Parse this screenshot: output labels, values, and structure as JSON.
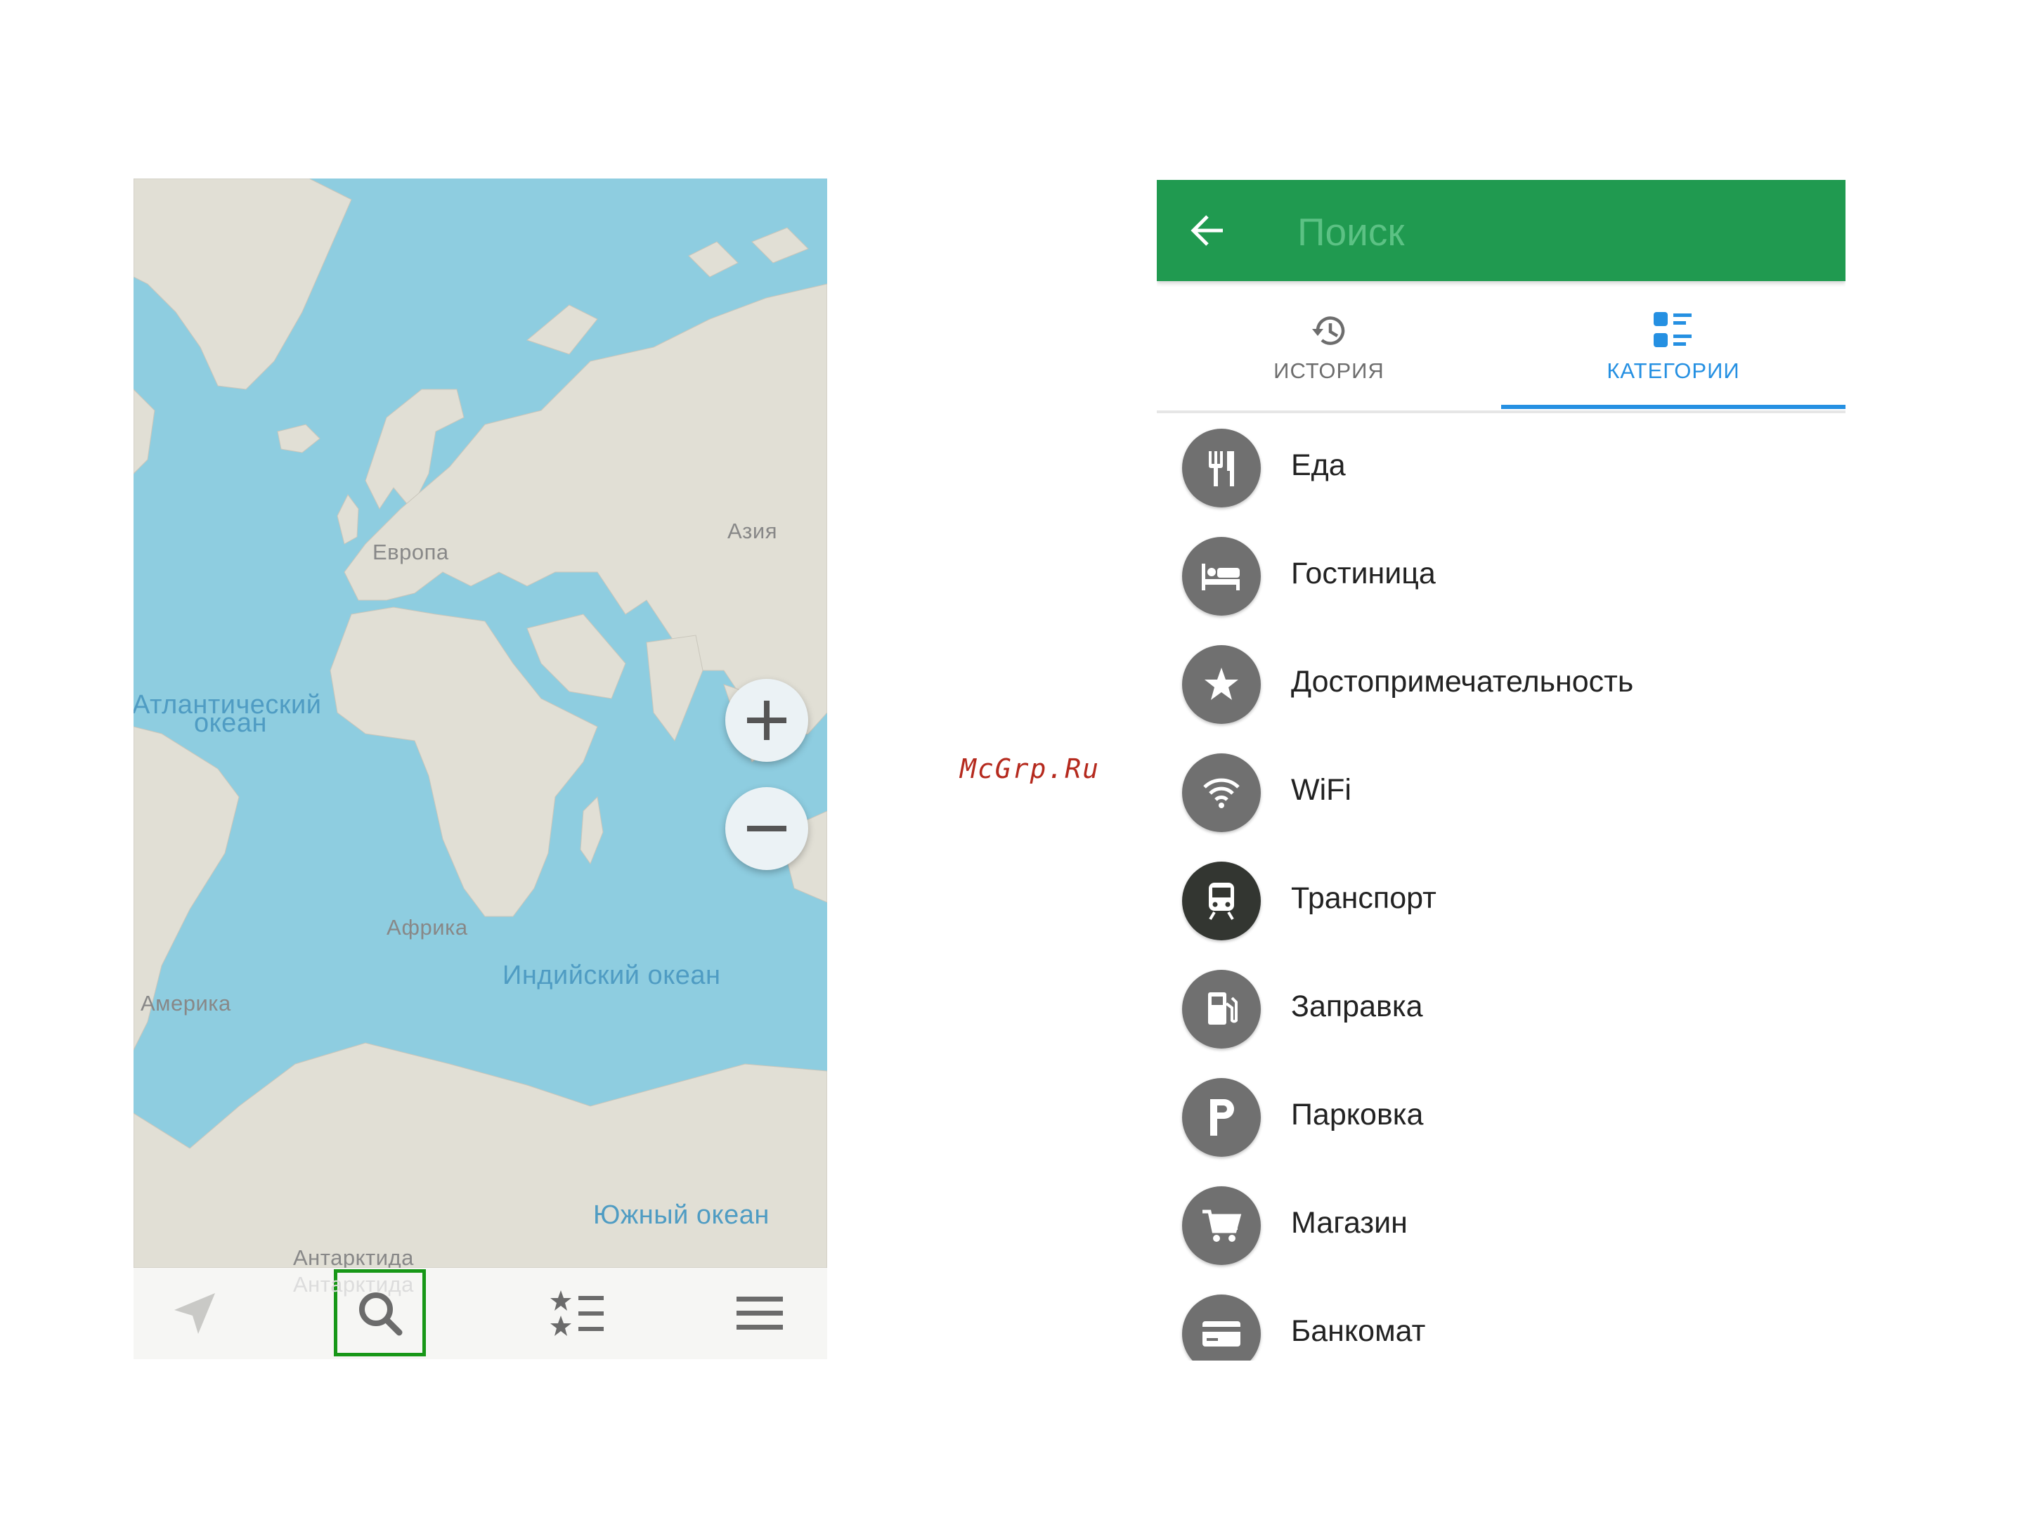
{
  "map_screen": {
    "labels": {
      "europe": "Европа",
      "asia": "Азия",
      "africa": "Африка",
      "america": "Америка",
      "antarctica": "Антарктида",
      "antarctica_ghost": "Антарктида",
      "atlantic_line1": "Атлантический",
      "atlantic_line2": "океан",
      "indian": "Индийский океан",
      "southern": "Южный океан"
    },
    "zoom": {
      "in_icon": "plus-icon",
      "out_icon": "minus-icon"
    },
    "bottom_bar": [
      {
        "name": "navigation",
        "icon": "navigation-arrow-icon"
      },
      {
        "name": "search",
        "icon": "search-icon",
        "highlighted": true
      },
      {
        "name": "bookmarks",
        "icon": "star-list-icon"
      },
      {
        "name": "menu",
        "icon": "hamburger-icon"
      }
    ],
    "colors": {
      "water": "#8ecde0",
      "land": "#e1dfd5",
      "highlight": "#179717"
    }
  },
  "watermark": "McGrp.Ru",
  "search_screen": {
    "toolbar": {
      "placeholder": "Поиск",
      "back_icon": "back-arrow-icon",
      "color": "#209a50"
    },
    "tabs": [
      {
        "label": "ИСТОРИЯ",
        "icon": "history-icon",
        "active": false
      },
      {
        "label": "КАТЕГОРИИ",
        "icon": "categories-icon",
        "active": true
      }
    ],
    "categories": [
      {
        "label": "Еда",
        "icon": "food-icon"
      },
      {
        "label": "Гостиница",
        "icon": "hotel-icon"
      },
      {
        "label": "Достопримечательность",
        "icon": "star-icon"
      },
      {
        "label": "WiFi",
        "icon": "wifi-icon"
      },
      {
        "label": "Транспорт",
        "icon": "train-icon"
      },
      {
        "label": "Заправка",
        "icon": "fuel-icon"
      },
      {
        "label": "Парковка",
        "icon": "parking-icon"
      },
      {
        "label": "Магазин",
        "icon": "cart-icon"
      },
      {
        "label": "Банкомат",
        "icon": "atm-card-icon"
      }
    ],
    "colors": {
      "accent": "#2590e2",
      "icon_bg": "#707070",
      "icon_bg_active": "#333631"
    }
  }
}
